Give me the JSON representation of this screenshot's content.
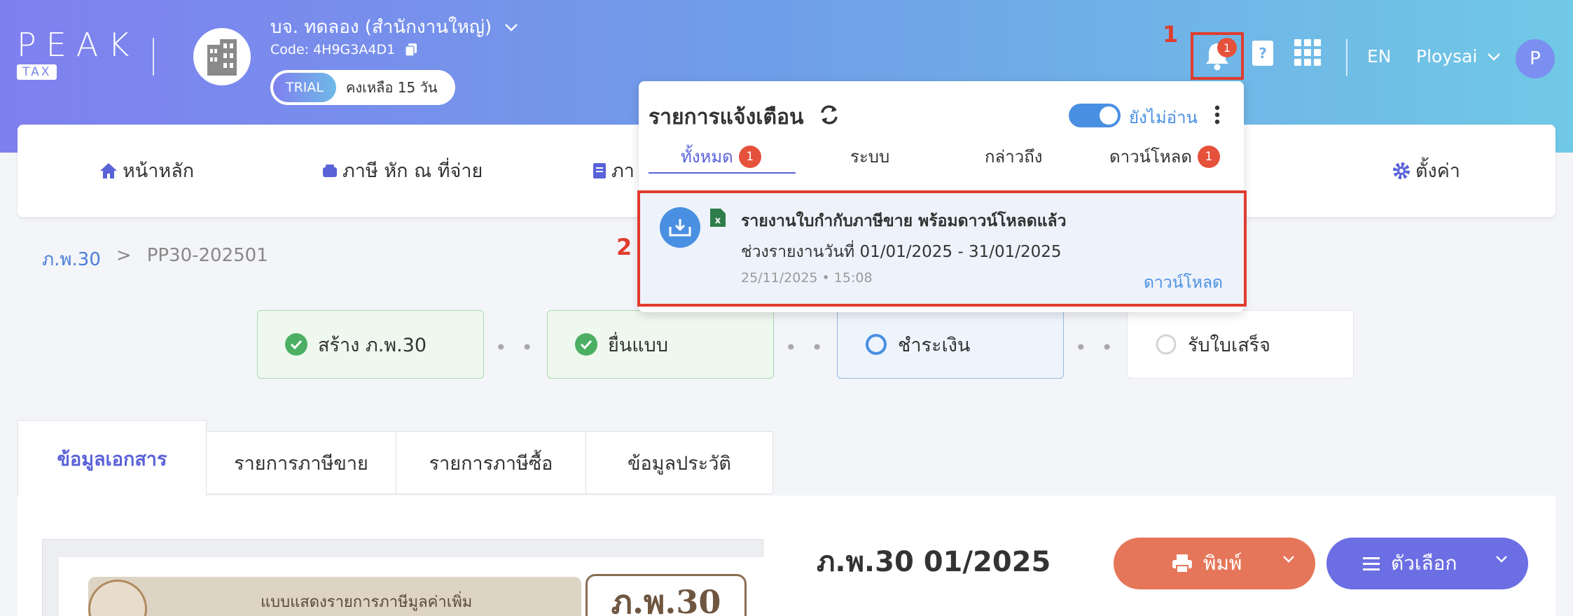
{
  "header": {
    "logo_main": "PEAK",
    "logo_sub": "TAX",
    "company_name": "บจ. ทดลอง (สำนักงานใหญ่)",
    "company_code": "Code: 4H9G3A4D1",
    "trial_badge": "TRIAL",
    "trial_remaining": "คงเหลือ 15 วัน",
    "bell_badge": "1",
    "lang": "EN",
    "username": "Ploysai",
    "avatar_letter": "P"
  },
  "markers": {
    "one": "1",
    "two": "2"
  },
  "nav": {
    "home": "หน้าหลัก",
    "wht": "ภาษี หัก ณ ที่จ่าย",
    "tax_partial": "ภา",
    "settings": "ตั้งค่า"
  },
  "breadcrumb": {
    "parent": "ภ.พ.30",
    "sep": ">",
    "current": "PP30-202501"
  },
  "steps": [
    {
      "label": "สร้าง ภ.พ.30",
      "status": "done"
    },
    {
      "label": "ยื่นแบบ",
      "status": "done"
    },
    {
      "label": "ชำระเงิน",
      "status": "current"
    },
    {
      "label": "รับใบเสร็จ",
      "status": "pending"
    }
  ],
  "step_dots": "• • •",
  "doc_tabs": [
    "ข้อมูลเอกสาร",
    "รายการภาษีขาย",
    "รายการภาษีซื้อ",
    "ข้อมูลประวัติ"
  ],
  "document": {
    "title": "ภ.พ.30 01/2025",
    "banner_text": "แบบแสดงรายการภาษีมูลค่าเพิ่ม",
    "form_code": "ภ.พ.30",
    "print_label": "พิมพ์",
    "options_label": "ตัวเลือก"
  },
  "notifications": {
    "title": "รายการแจ้งเตือน",
    "unread_label": "ยังไม่อ่าน",
    "tabs": [
      {
        "label": "ทั้งหมด",
        "badge": "1"
      },
      {
        "label": "ระบบ",
        "badge": ""
      },
      {
        "label": "กล่าวถึง",
        "badge": ""
      },
      {
        "label": "ดาวน์โหลด",
        "badge": "1"
      }
    ],
    "item": {
      "title": "รายงานใบกำกับภาษีขาย พร้อมดาวน์โหลดแล้ว",
      "description": "ช่วงรายงานวันที่ 01/01/2025 - 31/01/2025",
      "timestamp": "25/11/2025 • 15:08",
      "action": "ดาวน์โหลด"
    }
  },
  "colors": {
    "accent": "#5a62d8",
    "highlight_box": "#e03c2e",
    "link": "#4a90e2",
    "print_button": "#e67659",
    "options_button": "#6c6ee3"
  }
}
